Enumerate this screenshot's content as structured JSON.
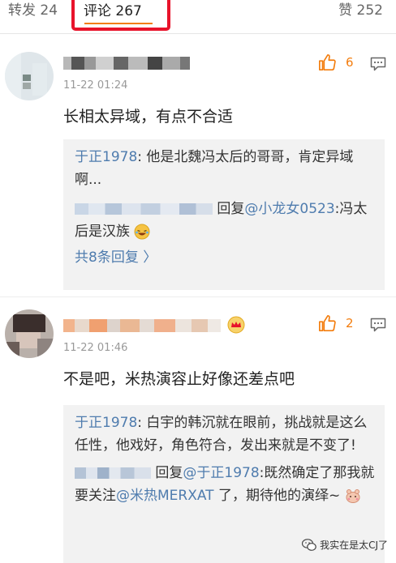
{
  "tabs": {
    "repost": "转发 24",
    "comments": "评论 267",
    "likes": "赞 252"
  },
  "comments": [
    {
      "time": "11-22 01:24",
      "likes": "6",
      "text": "长相太异域，有点不合适",
      "replies": [
        {
          "author": "于正1978",
          "sep": ": ",
          "text": "他是北魏冯太后的哥哥，肯定异域啊..."
        },
        {
          "reply_label": "回复",
          "mention": "@小龙女0523",
          "text": ":冯太后是汉族"
        }
      ],
      "more_replies": "共8条回复 〉"
    },
    {
      "time": "11-22 01:46",
      "likes": "2",
      "text": "不是吧，米热演容止好像还差点吧",
      "replies": [
        {
          "author": "于正1978",
          "sep": ": ",
          "text": "白宇的韩沉就在眼前，挑战就是这么任性，他戏好，角色符合，发出来就是不变了!"
        },
        {
          "reply_label": "回复",
          "mention": "@于正1978",
          "text_a": ":既然确定了那我就要关注",
          "mention2": "@米热MERXAT",
          "text_b": " 了，期待他的演绎~"
        }
      ]
    }
  ],
  "watermark": "我实在是太CJ了",
  "colors": {
    "accent": "#f37d0e",
    "link": "#4f7cae",
    "highlight_border": "#e8132b"
  }
}
